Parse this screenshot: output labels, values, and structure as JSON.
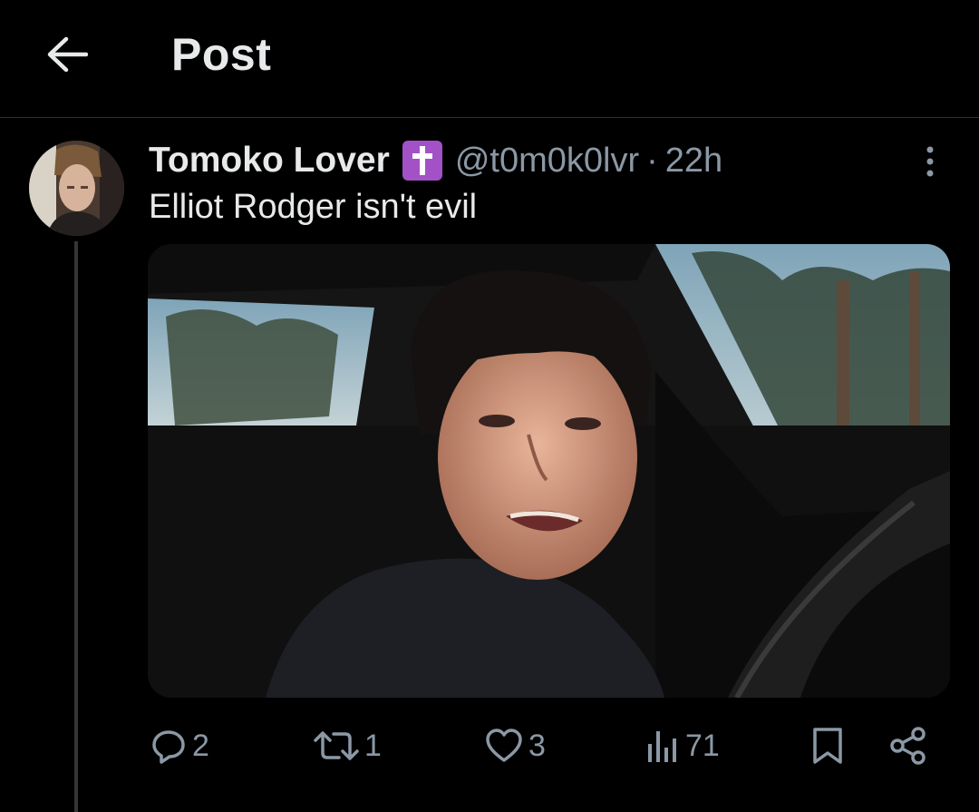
{
  "header": {
    "title": "Post",
    "back_icon": "arrow-left-icon"
  },
  "post": {
    "author_name": "Tomoko Lover",
    "badge_icon": "latin-cross-icon",
    "badge_color": "#a351c7",
    "handle": "@t0m0k0lvr",
    "separator": "·",
    "time": "22h",
    "text": "Elliot Rodger isn't evil",
    "more_icon": "more-vertical-icon"
  },
  "actions": {
    "replies": {
      "icon": "reply-icon",
      "count": "2"
    },
    "reposts": {
      "icon": "repost-icon",
      "count": "1"
    },
    "likes": {
      "icon": "heart-icon",
      "count": "3"
    },
    "views": {
      "icon": "views-icon",
      "count": "71"
    },
    "bookmark": {
      "icon": "bookmark-icon"
    },
    "share": {
      "icon": "share-icon"
    }
  },
  "colors": {
    "background": "#000000",
    "text": "#e7e9ea",
    "muted": "#8b98a5",
    "divider": "#2f3336"
  }
}
